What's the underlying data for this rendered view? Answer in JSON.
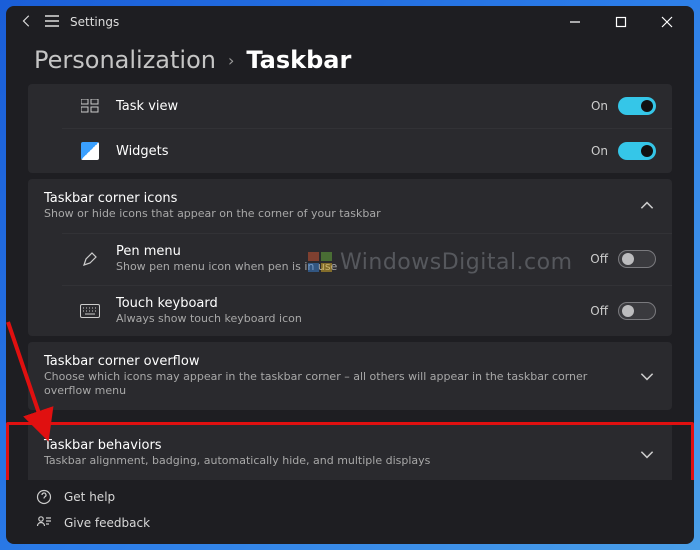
{
  "app": {
    "name": "Settings"
  },
  "breadcrumb": {
    "parent": "Personalization",
    "separator": "›",
    "current": "Taskbar"
  },
  "items": {
    "taskview": {
      "label": "Task view",
      "state": "On"
    },
    "widgets": {
      "label": "Widgets",
      "state": "On"
    }
  },
  "cornerIcons": {
    "title": "Taskbar corner icons",
    "desc": "Show or hide icons that appear on the corner of your taskbar",
    "pen": {
      "label": "Pen menu",
      "desc": "Show pen menu icon when pen is in use",
      "state": "Off"
    },
    "touch": {
      "label": "Touch keyboard",
      "desc": "Always show touch keyboard icon",
      "state": "Off"
    }
  },
  "overflow": {
    "title": "Taskbar corner overflow",
    "desc": "Choose which icons may appear in the taskbar corner – all others will appear in the taskbar corner overflow menu"
  },
  "behaviors": {
    "title": "Taskbar behaviors",
    "desc": "Taskbar alignment, badging, automatically hide, and multiple displays"
  },
  "footer": {
    "help": "Get help",
    "feedback": "Give feedback"
  },
  "watermark": "WindowsDigital.com"
}
